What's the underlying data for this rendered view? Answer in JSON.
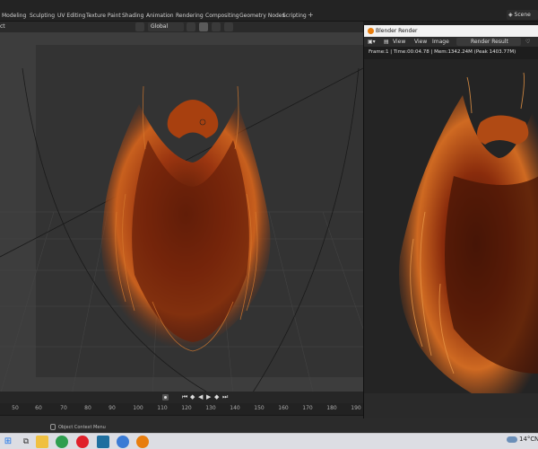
{
  "workspace_tabs": [
    "Modeling",
    "Sculpting",
    "UV Editing",
    "Texture Paint",
    "Shading",
    "Animation",
    "Rendering",
    "Compositing",
    "Geometry Nodes",
    "Scripting"
  ],
  "add_workspace": "+",
  "scene": {
    "label": "Scene"
  },
  "viewport_header": {
    "object_label": "ct",
    "transform_orientation": "Global"
  },
  "timeline": {
    "ruler_ticks": [
      "50",
      "60",
      "70",
      "80",
      "90",
      "100",
      "110",
      "120",
      "130",
      "140",
      "150",
      "160",
      "170",
      "180",
      "190"
    ],
    "playback_icons": [
      "jump-start-icon",
      "prev-keyframe-icon",
      "play-reverse-icon",
      "play-icon",
      "next-keyframe-icon",
      "jump-end-icon"
    ]
  },
  "status_bar": {
    "hint": "Object Context Menu"
  },
  "render_window": {
    "title": "Blender Render",
    "menu": {
      "view1": "View",
      "view2": "View",
      "image": "Image"
    },
    "slot_label": "Render Result",
    "stats": "Frame:1 | Time:00:04.78 | Mem:1342.24M (Peak 1403.77M)"
  },
  "taskbar": {
    "temperature": "14°C",
    "overflow": "N",
    "apps": [
      "windows-start-icon",
      "task-view-icon",
      "file-explorer-icon",
      "chrome-icon",
      "opera-icon",
      "malwarebytes-icon",
      "c-app-icon",
      "blender-icon"
    ]
  },
  "colors": {
    "viewport_bg": "#3d3d3d",
    "hair_dark": "#5a1d08",
    "hair_mid": "#b2400f",
    "hair_light": "#e0903a",
    "blender_orange": "#e87d0d"
  }
}
